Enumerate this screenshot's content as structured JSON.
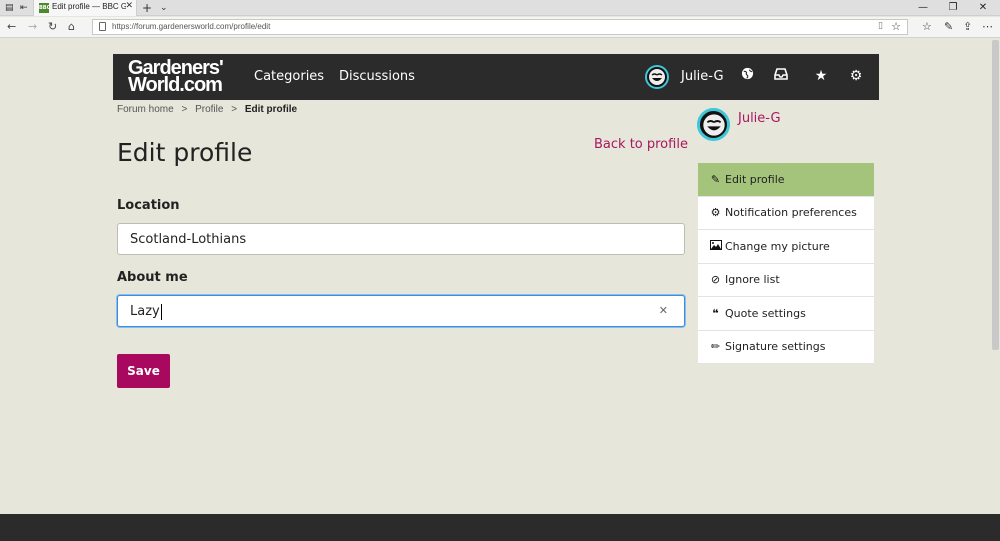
{
  "browser": {
    "tab_title": "Edit profile — BBC Gard",
    "favicon_text": "BBC",
    "url": "https://forum.gardenersworld.com/profile/edit"
  },
  "header": {
    "logo_line1": "Gardeners'",
    "logo_line2": "World.com",
    "nav": [
      "Categories",
      "Discussions"
    ],
    "username": "Julie-G"
  },
  "breadcrumb": {
    "items": [
      "Forum home",
      "Profile"
    ],
    "current": "Edit profile"
  },
  "page": {
    "title": "Edit profile",
    "back_link": "Back to profile"
  },
  "form": {
    "location_label": "Location",
    "location_value": "Scotland-Lothians",
    "about_label": "About me",
    "about_value": "Lazy",
    "save_label": "Save"
  },
  "sidebar": {
    "username": "Julie-G",
    "items": [
      {
        "label": "Edit profile",
        "icon": "edit-icon"
      },
      {
        "label": "Notification preferences",
        "icon": "gear-icon"
      },
      {
        "label": "Change my picture",
        "icon": "picture-icon"
      },
      {
        "label": "Ignore list",
        "icon": "ban-icon"
      },
      {
        "label": "Quote settings",
        "icon": "quote-icon"
      },
      {
        "label": "Signature settings",
        "icon": "pencil-icon"
      }
    ]
  },
  "colors": {
    "accent": "#a8085e",
    "link": "#a8175f",
    "active_item": "#a5c47b",
    "header_bg": "#2b2b2b",
    "page_bg": "#e7e6da"
  }
}
